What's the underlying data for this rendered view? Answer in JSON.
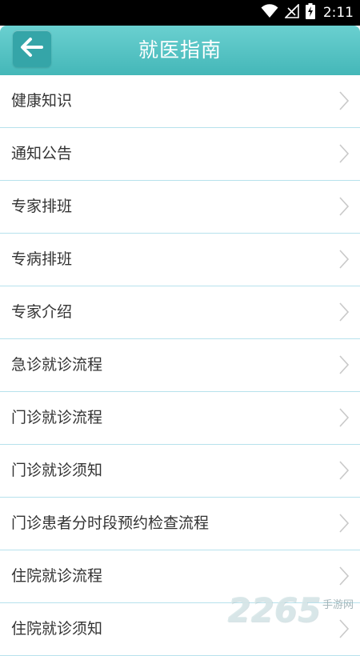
{
  "status_bar": {
    "time": "2:11",
    "icons": [
      "wifi-icon",
      "signal-off-icon",
      "battery-charging-icon"
    ]
  },
  "header": {
    "title": "就医指南",
    "back_icon": "arrow-left-icon"
  },
  "colors": {
    "header": "#44b7b8",
    "back_button": "#35a5a8",
    "divider": "#b7e2ec"
  },
  "items": [
    {
      "label": "健康知识"
    },
    {
      "label": "通知公告"
    },
    {
      "label": "专家排班"
    },
    {
      "label": "专病排班"
    },
    {
      "label": "专家介绍"
    },
    {
      "label": "急诊就诊流程"
    },
    {
      "label": "门诊就诊流程"
    },
    {
      "label": "门诊就诊须知"
    },
    {
      "label": "门诊患者分时段预约检查流程"
    },
    {
      "label": "住院就诊流程"
    },
    {
      "label": "住院就诊须知"
    }
  ],
  "watermark": {
    "number": "2265",
    "site": "手游网"
  }
}
